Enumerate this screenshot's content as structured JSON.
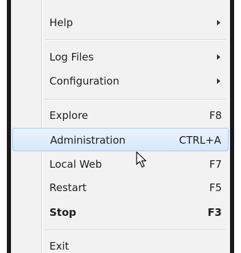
{
  "menu": {
    "items": [
      {
        "label": "Help",
        "shortcut": "",
        "submenu": true
      },
      {
        "label": "Log Files",
        "shortcut": "",
        "submenu": true
      },
      {
        "label": "Configuration",
        "shortcut": "",
        "submenu": true
      },
      {
        "label": "Explore",
        "shortcut": "F8",
        "submenu": false
      },
      {
        "label": "Administration",
        "shortcut": "CTRL+A",
        "submenu": false,
        "highlighted": true
      },
      {
        "label": "Local Web",
        "shortcut": "F7",
        "submenu": false
      },
      {
        "label": "Restart",
        "shortcut": "F5",
        "submenu": false
      },
      {
        "label": "Stop",
        "shortcut": "F3",
        "submenu": false,
        "bold": true
      },
      {
        "label": "Exit",
        "shortcut": "",
        "submenu": false
      }
    ]
  },
  "cursor": {
    "icon": "arrow-pointer-icon"
  },
  "colors": {
    "highlight_top": "#eaf3fd",
    "highlight_bottom": "#d6e8fb",
    "highlight_border": "#a9c9ec",
    "menu_background": "#f2f2f2"
  }
}
